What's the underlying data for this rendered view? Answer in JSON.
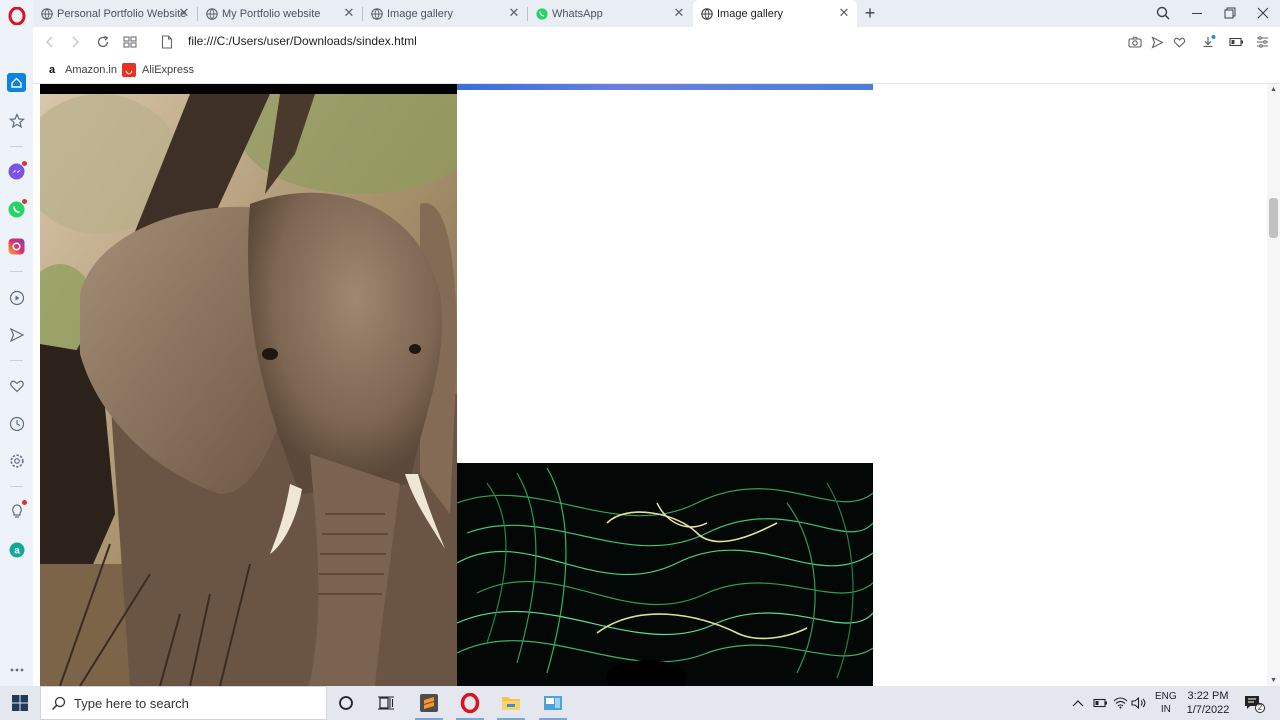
{
  "browser": {
    "tabs": [
      {
        "title": "Personal Portfolio Website",
        "active": false
      },
      {
        "title": "My Portfolio website",
        "active": false
      },
      {
        "title": "Image gallery",
        "active": false
      },
      {
        "title": "WhatsApp",
        "active": false
      },
      {
        "title": "Image gallery",
        "active": true
      }
    ],
    "address": "file:///C:/Users/user/Downloads/sindex.html",
    "bookmarks": [
      {
        "label": "Amazon.in",
        "icon": "amazon-icon"
      },
      {
        "label": "AliExpress",
        "icon": "aliexpress-icon"
      }
    ]
  },
  "page": {
    "images": [
      {
        "name": "elephant-photo",
        "alt": "elephant"
      },
      {
        "name": "light-painting-photo",
        "alt": "green light trails"
      }
    ],
    "accent_bar_color": "#4a7fd8"
  },
  "taskbar": {
    "search_placeholder": "Type here to search",
    "lang_top": "ENG",
    "lang_bottom": "IN",
    "time": "3:22 PM",
    "date": "1/7/2022",
    "notifications": "2"
  }
}
